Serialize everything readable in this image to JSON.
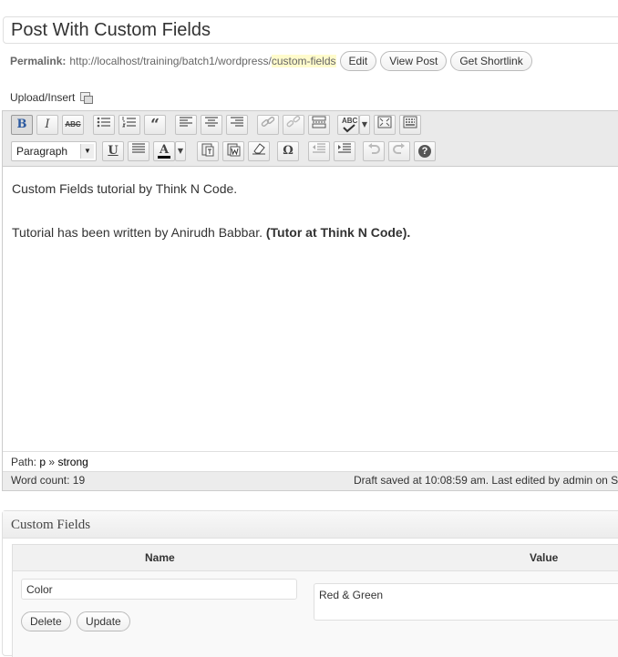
{
  "post": {
    "title": "Post With Custom Fields"
  },
  "permalink": {
    "label": "Permalink:",
    "base": "http://localhost/training/batch1/wordpress/",
    "slug": "custom-fields",
    "edit_label": "Edit",
    "view_post_label": "View Post",
    "shortlink_label": "Get Shortlink"
  },
  "upload": {
    "label": "Upload/Insert"
  },
  "toolbar": {
    "bold": "B",
    "italic": "I",
    "strike": "ABC",
    "blockquote": "“",
    "spellcheck": "ABC",
    "format_select": "Paragraph",
    "underline": "U",
    "text_color": "A",
    "omega": "Ω",
    "help": "?"
  },
  "content": {
    "line1": "Custom Fields tutorial by Think N Code.",
    "line2_plain": "Tutorial has been written by Anirudh Babbar. ",
    "line2_strong": "(Tutor at Think N Code)."
  },
  "path": {
    "label": "Path:",
    "p": "p",
    "sep": "»",
    "strong": "strong"
  },
  "status": {
    "word_count": "Word count: 19",
    "draft_saved": "Draft saved at 10:08:59 am. Last edited by admin on S"
  },
  "custom_fields": {
    "title": "Custom Fields",
    "col_name": "Name",
    "col_value": "Value",
    "rows": [
      {
        "name": "Color",
        "value": "Red & Green",
        "delete_label": "Delete",
        "update_label": "Update"
      }
    ]
  }
}
